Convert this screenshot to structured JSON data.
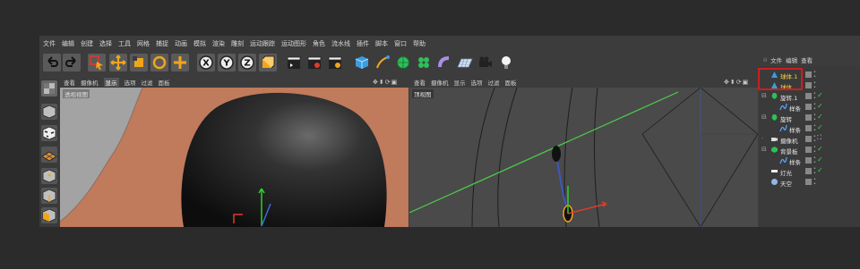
{
  "menu": [
    "文件",
    "编辑",
    "创建",
    "选择",
    "工具",
    "网格",
    "捕捉",
    "动画",
    "模拟",
    "渲染",
    "雕刻",
    "运动跟踪",
    "运动图形",
    "角色",
    "流水线",
    "插件",
    "脚本",
    "窗口",
    "帮助"
  ],
  "toolbar": {
    "axis_x": "X",
    "axis_y": "Y",
    "axis_z": "Z"
  },
  "left_viewport": {
    "menu": [
      "查看",
      "摄像机",
      "显示",
      "选项",
      "过滤",
      "面板"
    ],
    "active_menu": "显示",
    "label": "透视视图"
  },
  "right_viewport": {
    "menu": [
      "查看",
      "摄像机",
      "显示",
      "选项",
      "过滤",
      "面板"
    ],
    "label": "顶视图"
  },
  "nav_icons": "✥⬍⟳▣",
  "object_manager": {
    "tabs": [
      "文件",
      "编辑",
      "查看"
    ],
    "objects": [
      {
        "name": "球体.1",
        "selected": true,
        "icon": "sphere-icon",
        "level": 0
      },
      {
        "name": "球体",
        "selected": true,
        "icon": "sphere-icon",
        "level": 0
      },
      {
        "name": "旋转.1",
        "selected": false,
        "icon": "lathe-icon",
        "level": 0
      },
      {
        "name": "样条",
        "selected": false,
        "icon": "spline-icon",
        "level": 1
      },
      {
        "name": "旋转",
        "selected": false,
        "icon": "lathe-icon",
        "level": 0
      },
      {
        "name": "样条",
        "selected": false,
        "icon": "spline-icon",
        "level": 1
      },
      {
        "name": "摄像机",
        "selected": false,
        "icon": "camera-icon",
        "level": 0
      },
      {
        "name": "背景板",
        "selected": false,
        "icon": "background-icon",
        "level": 0
      },
      {
        "name": "样条",
        "selected": false,
        "icon": "spline-icon",
        "level": 1
      },
      {
        "name": "灯光",
        "selected": false,
        "icon": "light-icon",
        "level": 0
      },
      {
        "name": "天空",
        "selected": false,
        "icon": "sky-icon",
        "level": 0
      }
    ]
  },
  "colors": {
    "accent_orange": "#f2a51a",
    "selection_yellow": "#ffd24a",
    "highlight_red": "#cc1f1f",
    "background_plane": "#c07a5c"
  }
}
